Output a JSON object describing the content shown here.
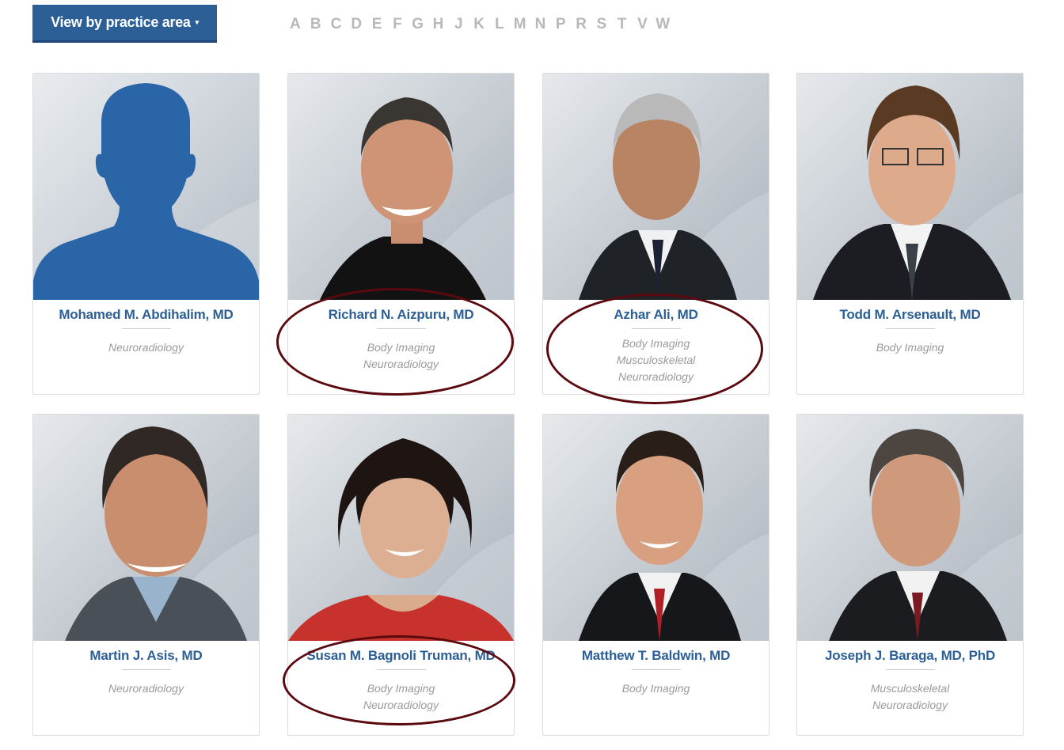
{
  "toolbar": {
    "practice_button_label": "View by practice area",
    "caret": "▾"
  },
  "alphabet": [
    "A",
    "B",
    "C",
    "D",
    "E",
    "F",
    "G",
    "H",
    "J",
    "K",
    "L",
    "M",
    "N",
    "P",
    "R",
    "S",
    "T",
    "V",
    "W"
  ],
  "doctors": [
    {
      "name": "Mohamed M. Abdihalim, MD",
      "areas": [
        "Neuroradiology"
      ],
      "photo": "silhouette-placeholder"
    },
    {
      "name": "Richard N. Aizpuru, MD",
      "areas": [
        "Body Imaging",
        "Neuroradiology"
      ],
      "photo": "portrait"
    },
    {
      "name": "Azhar Ali, MD",
      "areas": [
        "Body Imaging",
        "Musculoskeletal",
        "Neuroradiology"
      ],
      "photo": "portrait"
    },
    {
      "name": "Todd M. Arsenault, MD",
      "areas": [
        "Body Imaging"
      ],
      "photo": "portrait"
    },
    {
      "name": "Martin J. Asis, MD",
      "areas": [
        "Neuroradiology"
      ],
      "photo": "portrait"
    },
    {
      "name": "Susan M. Bagnoli Truman, MD",
      "areas": [
        "Body Imaging",
        "Neuroradiology"
      ],
      "photo": "portrait"
    },
    {
      "name": "Matthew T. Baldwin, MD",
      "areas": [
        "Body Imaging"
      ],
      "photo": "portrait"
    },
    {
      "name": "Joseph J. Baraga, MD, PhD",
      "areas": [
        "Musculoskeletal",
        "Neuroradiology"
      ],
      "photo": "portrait"
    }
  ],
  "annotations": {
    "circled_cards": [
      "Richard N. Aizpuru, MD",
      "Azhar Ali, MD",
      "Susan M. Bagnoli Truman, MD"
    ],
    "oval_color": "#5a0a0f"
  },
  "colors": {
    "primary_button": "#2b5f96",
    "name_link": "#2b5f96",
    "alphabet_link": "#b8b8b8",
    "area_text": "#9a9a9a"
  }
}
